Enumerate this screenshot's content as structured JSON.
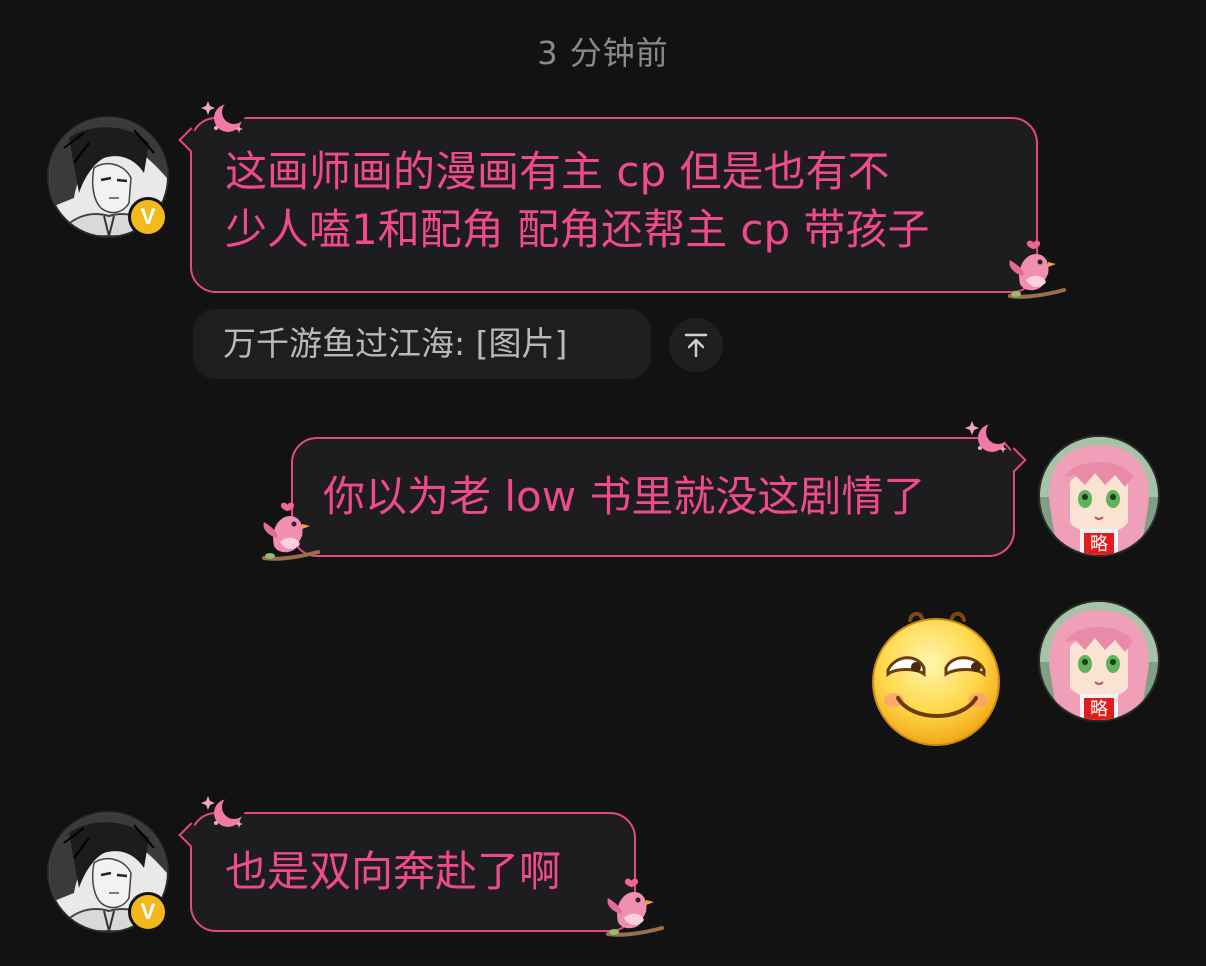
{
  "timestamp": "3 分钟前",
  "messages": [
    {
      "line1": "这画师画的漫画有主 cp 但是也有不",
      "line2": "少人嗑1和配角 配角还帮主 cp 带孩子"
    },
    {
      "text": "你以为老 low 书里就没这剧情了"
    },
    {
      "text": "也是双向奔赴了啊"
    }
  ],
  "quote": {
    "text": "万千游鱼过江海: [图片]"
  },
  "badge_letter": "V",
  "avatar_badge_text": "略",
  "icons": [
    "verified-badge-icon",
    "scroll-to-quote-icon",
    "moon-sparkle-deco-icon",
    "pink-bird-deco-icon",
    "grin-emoji-sticker"
  ],
  "colors": {
    "accent": "#e3487f",
    "text_pink": "#ef4a8b",
    "background": "#121212",
    "bubble": "#1d1d1f",
    "badge": "#f3b81c"
  }
}
